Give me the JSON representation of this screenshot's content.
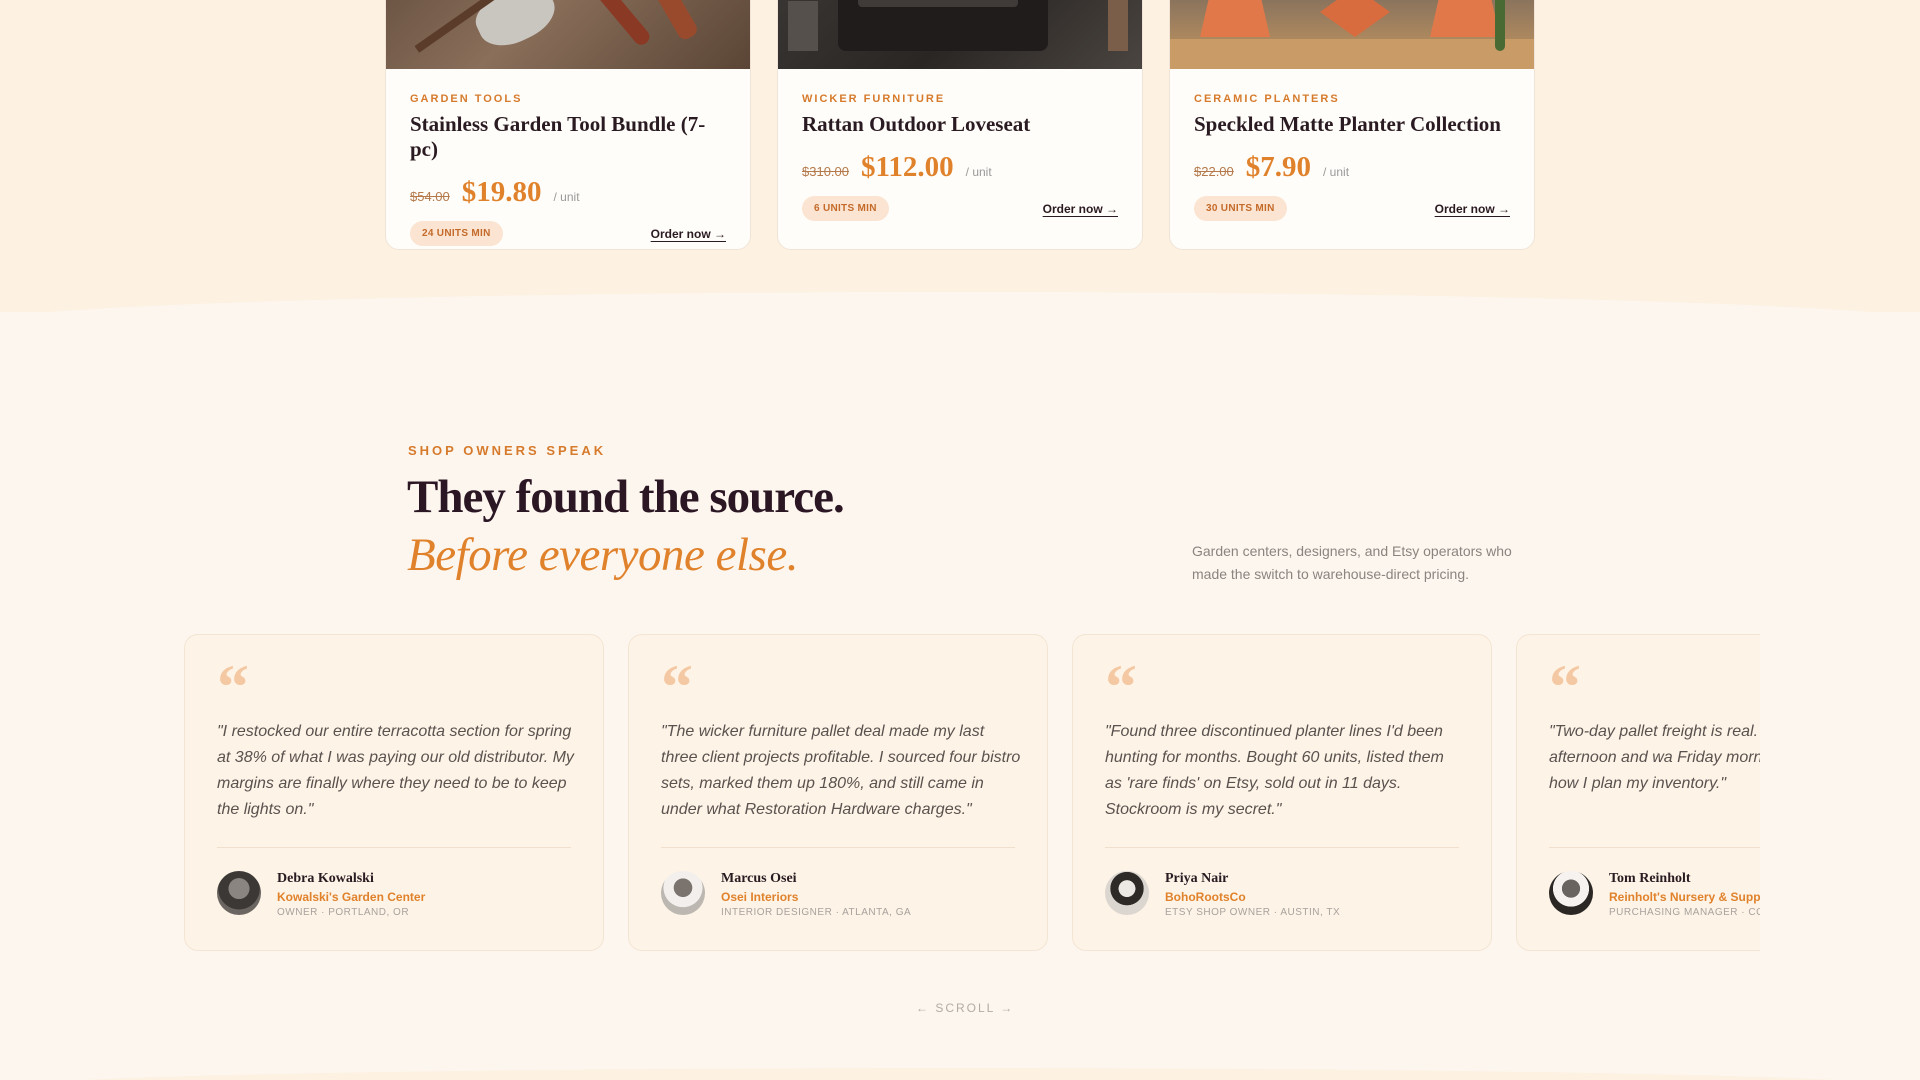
{
  "products": [
    {
      "category": "GARDEN TOOLS",
      "name": "Stainless Garden Tool Bundle (7-pc)",
      "old_price": "$54.00",
      "price": "$19.80",
      "unit": "/ unit",
      "min_badge": "24 UNITS MIN",
      "order_label": "Order now →",
      "image": "garden-tools-photo"
    },
    {
      "category": "WICKER FURNITURE",
      "name": "Rattan Outdoor Loveseat",
      "old_price": "$310.00",
      "price": "$112.00",
      "unit": "/ unit",
      "min_badge": "6 UNITS MIN",
      "order_label": "Order now →",
      "image": "wicker-loveseat-photo"
    },
    {
      "category": "CERAMIC PLANTERS",
      "name": "Speckled Matte Planter Collection",
      "old_price": "$22.00",
      "price": "$7.90",
      "unit": "/ unit",
      "min_badge": "30 UNITS MIN",
      "order_label": "Order now →",
      "image": "ceramic-planters-photo"
    }
  ],
  "testimonials_section": {
    "eyebrow": "SHOP OWNERS SPEAK",
    "headline": "They found the source.",
    "headline_italic": "Before everyone else.",
    "intro": "Garden centers, designers, and Etsy operators who made the switch to warehouse-direct pricing.",
    "scroll_hint": "← SCROLL →",
    "quote_glyph": "“",
    "items": [
      {
        "quote": "\"I restocked our entire terracotta section for spring at 38% of what I was paying our old distributor. My margins are finally where they need to be to keep the lights on.\"",
        "name": "Debra Kowalski",
        "company": "Kowalski's Garden Center",
        "role": "OWNER · PORTLAND, OR"
      },
      {
        "quote": "\"The wicker furniture pallet deal made my last three client projects profitable. I sourced four bistro sets, marked them up 180%, and still came in under what Restoration Hardware charges.\"",
        "name": "Marcus Osei",
        "company": "Osei Interiors",
        "role": "INTERIOR DESIGNER · ATLANTA, GA"
      },
      {
        "quote": "\"Found three discontinued planter lines I'd been hunting for months. Bought 60 units, listed them as 'rare finds' on Etsy, sold out in 11 days. Stockroom is my secret.\"",
        "name": "Priya Nair",
        "company": "BohoRootsCo",
        "role": "ETSY SHOP OWNER · AUSTIN, TX"
      },
      {
        "quote": "\"Two-day pallet freight is real. Wednesday afternoon and wa Friday morning. That kind of ti how I plan my inventory.\"",
        "name": "Tom Reinholt",
        "company": "Reinholt's Nursery & Supp",
        "role": "PURCHASING MANAGER · CO"
      }
    ]
  },
  "colors": {
    "accent": "#e0822c",
    "heading": "#2b1624",
    "background": "#fdf6ee"
  }
}
